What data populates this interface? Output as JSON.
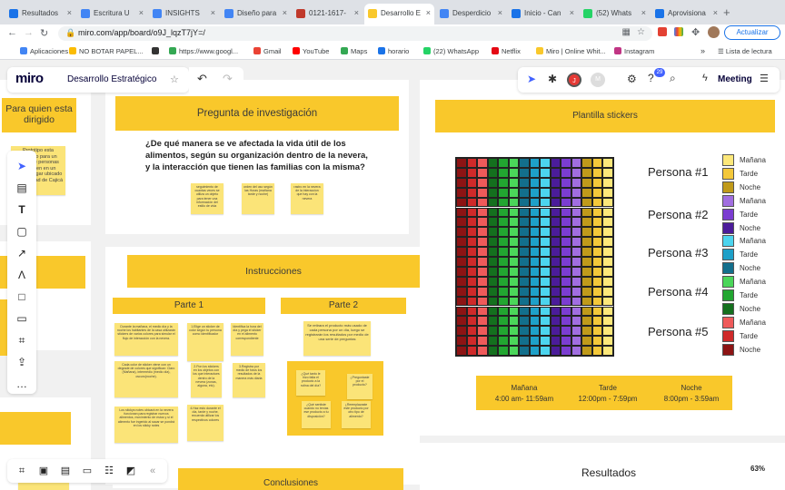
{
  "tabs": [
    {
      "label": "Resultados",
      "color": "#1a73e8"
    },
    {
      "label": "Escritura U",
      "color": "#4285f4"
    },
    {
      "label": "INSIGHTS",
      "color": "#4285f4"
    },
    {
      "label": "Diseño para",
      "color": "#4285f4"
    },
    {
      "label": "0121-1617-",
      "color": "#c0392b"
    },
    {
      "label": "Desarrollo E",
      "color": "#f9c82b"
    },
    {
      "label": "Desperdicio",
      "color": "#4285f4"
    },
    {
      "label": "Inicio - Can",
      "color": "#1a73e8"
    },
    {
      "label": "(52) Whats",
      "color": "#25d366"
    },
    {
      "label": "Aprovisiona",
      "color": "#1a73e8"
    }
  ],
  "tab_close": "×",
  "tab_new": "+",
  "url": "miro.com/app/board/o9J_lqzT7jY=/",
  "update_button": "Actualizar",
  "bookmarks": [
    {
      "label": "Aplicaciones",
      "color": "#4285f4"
    },
    {
      "label": "NO BOTAR PAPEL...",
      "color": "#fbbc04"
    },
    {
      "label": "",
      "color": "#333"
    },
    {
      "label": "https://www.googl...",
      "color": "#34a853"
    },
    {
      "label": "Gmail",
      "color": "#ea4335"
    },
    {
      "label": "YouTube",
      "color": "#ff0000"
    },
    {
      "label": "Maps",
      "color": "#34a853"
    },
    {
      "label": "horario",
      "color": "#1a73e8"
    },
    {
      "label": "(22) WhatsApp",
      "color": "#25d366"
    },
    {
      "label": "Netflix",
      "color": "#e50914"
    },
    {
      "label": "Miro | Online Whit...",
      "color": "#f9c82b"
    },
    {
      "label": "Instagram",
      "color": "#c13584"
    }
  ],
  "bookmarks_more": "»",
  "reading_list": "Lista de lectura",
  "miro": {
    "logo": "miro",
    "board_name": "Desarrollo Estratégico",
    "star": "☆",
    "meeting": "Meeting",
    "notification_count": "29",
    "avatar_j": "J",
    "avatar_m": "M",
    "zoom": "63%"
  },
  "board": {
    "left_header": "Para quien esta dirigido",
    "left_sticky": "Prototipo esta pensado para un grupo de personas que viven en un mismo hogar ubicado en la ciudad de Cajicá",
    "question_header": "Pregunta de investigación",
    "question": "¿De qué manera se ve afectada la vida útil de los alimentos, según su organización dentro de la nevera, y la interacción que tienen las familias con la misma?",
    "question_stickies": [
      "seguimiento de cuantas veces se utiliza un objeto para tener una información del estilo de vida",
      "orden del uso según las Horas (mañana tarde y noche)",
      "rastro en la nevera de la interaccion que hay con la nevera"
    ],
    "instructions_header": "Instrucciones",
    "part1": "Parte 1",
    "part2": "Parte 2",
    "part1_stickies": [
      "Durante la mañana, el medio día y la noche los habitantes de la casa utilizarán stickers de varios colores para simular el flujo de interacción con la nevera.",
      "1.Elige un sticker de color según tu persona como identificador",
      "Identifica la hora del día y pega el sticker en el alimento correspondiente",
      "Cada color de sticker viene con un degrade de colores que significan: Claro (Mañana), intermedio (medio día), oscuro(noche).",
      "2.Pon los stickers en los objetos con los que interactues dentro de la nevera (zonas, alguna, etc).",
      "3.Registra por medio de fotos los resultados de la manera más diaria",
      "Los stickys notes ubicará en la nevera funcionan para registrar nuevos alimentos, movimiento de estos y si el alimento fue ingerido al sacar se pondrá en los sticky notes",
      "4.Haz esto durante el día, tarde y noche, recuerda utilizar los respectivos colores"
    ],
    "part2_intro": "Se retirara el producto más usado de cada persona por un día, luego se registrarán los resultados por medio de una serie de preguntas",
    "part2_stickies": [
      "¿Qué tanto le hizo falta el producto a la rutina del día?",
      "¿Preguntaste por el producto?",
      "¿Qué sentiste cuando no tenías ese producto a tu disposición?",
      "¿Reemplazaste este producto por otro tipo de alimento?"
    ],
    "conclusions_header": "Conclusiones",
    "stickers_header": "Plantilla stickers",
    "persons": [
      "Persona #1",
      "Persona #2",
      "Persona #3",
      "Persona #4",
      "Persona #5"
    ],
    "legend": [
      {
        "label": "Mañana",
        "color": "#fde87a"
      },
      {
        "label": "Tarde",
        "color": "#f4c83a"
      },
      {
        "label": "Noche",
        "color": "#c09a1a"
      },
      {
        "label": "Mañana",
        "color": "#a16ee0"
      },
      {
        "label": "Tarde",
        "color": "#7b3dd1"
      },
      {
        "label": "Noche",
        "color": "#4b1c9a"
      },
      {
        "label": "Mañana",
        "color": "#4cd4ee"
      },
      {
        "label": "Tarde",
        "color": "#1ea0c8"
      },
      {
        "label": "Noche",
        "color": "#136f8c"
      },
      {
        "label": "Mañana",
        "color": "#4bd65a"
      },
      {
        "label": "Tarde",
        "color": "#22a631"
      },
      {
        "label": "Noche",
        "color": "#14701e"
      },
      {
        "label": "Mañana",
        "color": "#ef5a5a"
      },
      {
        "label": "Tarde",
        "color": "#cf2a2a"
      },
      {
        "label": "Noche",
        "color": "#8d1414"
      }
    ],
    "grid_column_colors": [
      "#8d1414",
      "#cf2a2a",
      "#ef5a5a",
      "#14701e",
      "#22a631",
      "#4bd65a",
      "#136f8c",
      "#1ea0c8",
      "#4cd4ee",
      "#4b1c9a",
      "#7b3dd1",
      "#a16ee0",
      "#c09a1a",
      "#f4c83a",
      "#fde87a"
    ],
    "grid_rows": 20,
    "times": [
      {
        "name": "Mañana",
        "range": "4:00 am- 11:59am"
      },
      {
        "name": "Tarde",
        "range": "12:00pm - 7:59pm"
      },
      {
        "name": "Noche",
        "range": "8:00pm - 3:59am"
      }
    ],
    "results_header": "Resultados"
  }
}
